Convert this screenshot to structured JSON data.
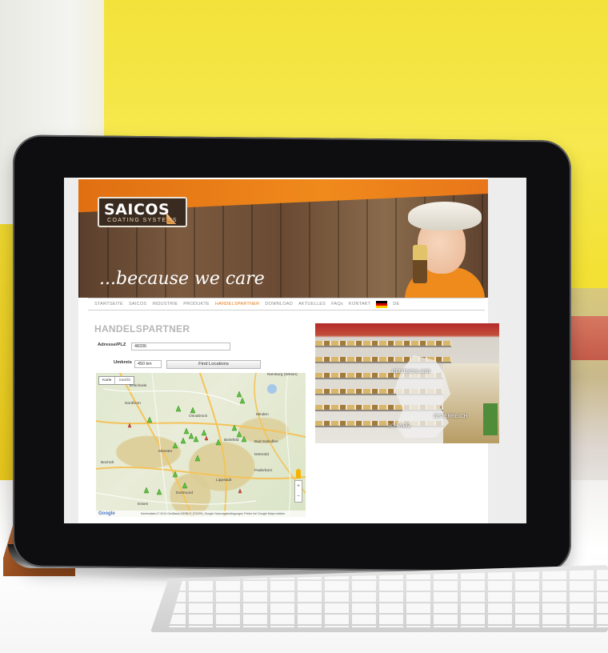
{
  "brand": {
    "name": "SAICOS",
    "subtitle": "COATING SYSTEMS",
    "slogan": "...because we care"
  },
  "nav": {
    "items": [
      "STARTSEITE",
      "SAICOS",
      "INDUSTRIE",
      "PRODUKTE",
      "HANDELSPARTNER",
      "DOWNLOAD",
      "AKTUELLES",
      "FAQs",
      "KONTAKT"
    ],
    "active": "HANDELSPARTNER",
    "language": "DE"
  },
  "partner": {
    "title": "HANDELSPARTNER",
    "address_label": "Adresse/PLZ",
    "address_value": "48336",
    "radius_label": "Umkreis",
    "radius_value": "450 km",
    "find_button": "Find Locations"
  },
  "map": {
    "tab_map": "Karte",
    "tab_satellite": "Satellit",
    "cities": [
      "Enschede",
      "Nordhorn",
      "Münster",
      "Bielefeld",
      "Osnabrück",
      "Dortmund",
      "Essen",
      "Paderborn",
      "Detmold",
      "Minden",
      "Bad Salzuflen",
      "Lippstadt",
      "Bocholt",
      "Nienburg (Weser)"
    ],
    "footer": "Kartendaten © 2014 GeoBasis-DE/BKG (©2009), Google   Nutzungsbedingungen   Fehler bei Google Maps melden",
    "google": "Google",
    "zoom_in": "+",
    "zoom_out": "−"
  },
  "shop": {
    "labels": [
      "DEUTSCHLAND",
      "SCHWEIZ",
      "ÖSTERREICH"
    ]
  },
  "colors": {
    "accent": "#e4791a",
    "nav_text": "#8a8a8a",
    "title": "#b6b6b6"
  }
}
